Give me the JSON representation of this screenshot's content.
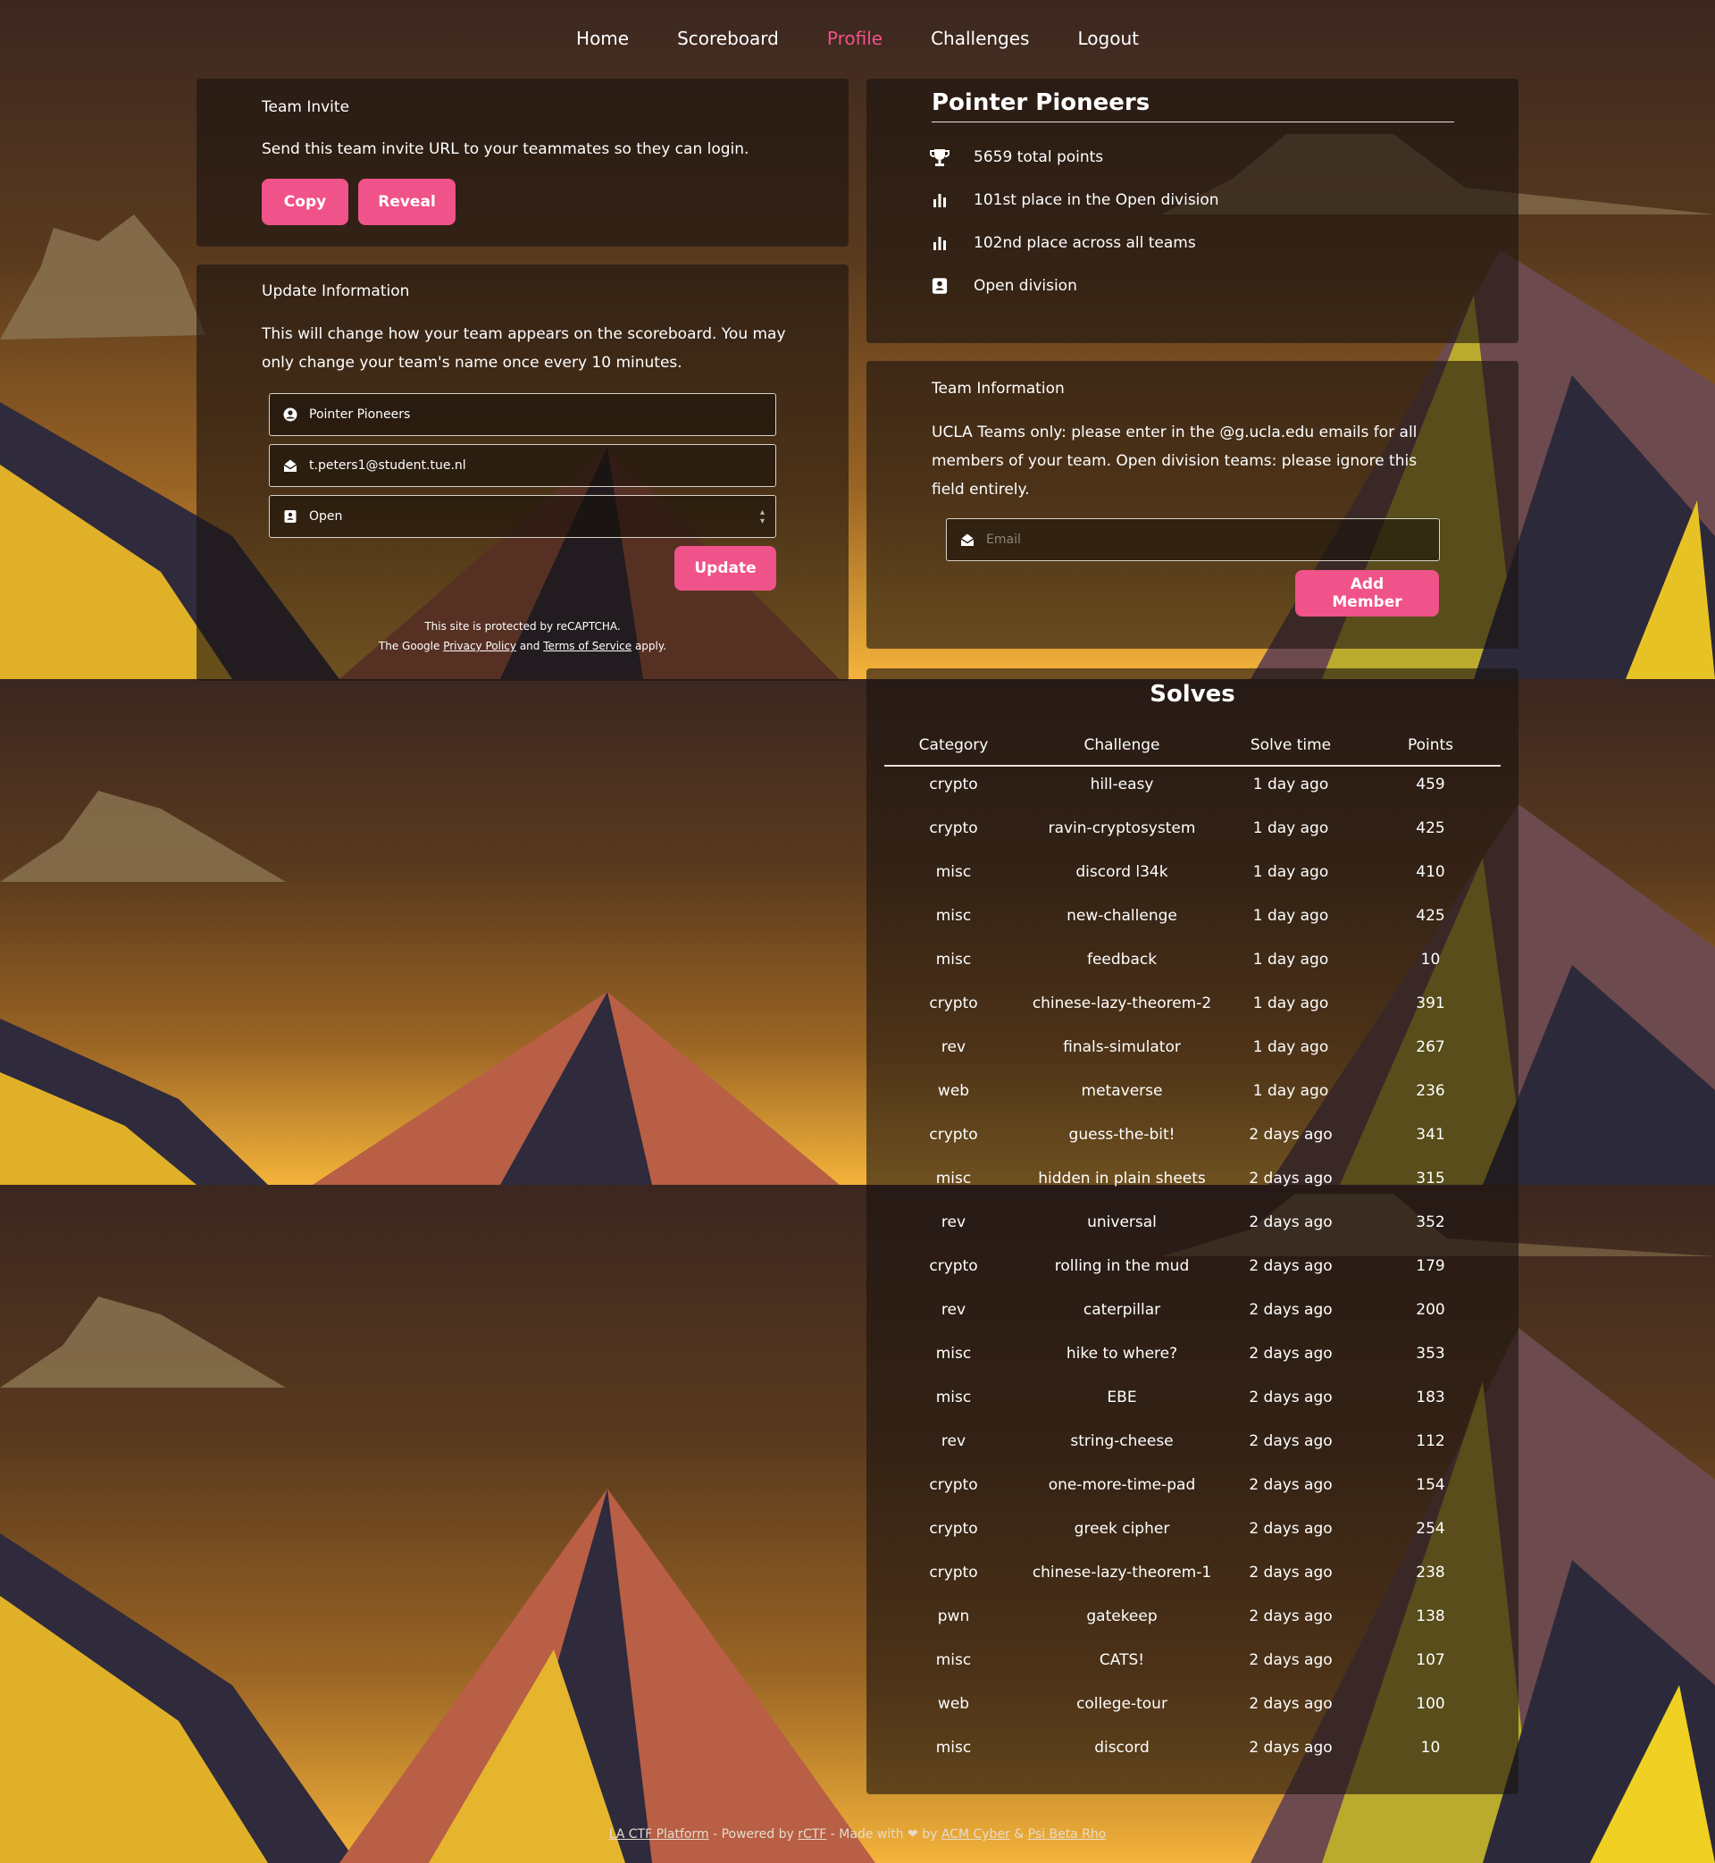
{
  "nav": {
    "items": [
      {
        "label": "Home",
        "active": false
      },
      {
        "label": "Scoreboard",
        "active": false
      },
      {
        "label": "Profile",
        "active": true
      },
      {
        "label": "Challenges",
        "active": false
      },
      {
        "label": "Logout",
        "active": false
      }
    ]
  },
  "invite": {
    "title": "Team Invite",
    "text": "Send this team invite URL to your teammates so they can login.",
    "copy_label": "Copy",
    "reveal_label": "Reveal"
  },
  "update": {
    "title": "Update Information",
    "text": "This will change how your team appears on the scoreboard. You may only change your team's name once every 10 minutes.",
    "name_value": "Pointer Pioneers",
    "email_value": "t.peters1@student.tue.nl",
    "division_value": "Open",
    "update_label": "Update",
    "recaptcha_line1": "This site is protected by reCAPTCHA.",
    "recaptcha_pre": "The Google",
    "privacy_label": "Privacy Policy",
    "and_label": "and",
    "terms_label": "Terms of Service",
    "apply_label": "apply."
  },
  "team": {
    "name": "Pointer Pioneers",
    "points": "5659 total points",
    "division_place": "101st place in the Open division",
    "overall_place": "102nd place across all teams",
    "division": "Open division"
  },
  "team_info": {
    "title": "Team Information",
    "text": "UCLA Teams only: please enter in the @g.ucla.edu emails for all members of your team. Open division teams: please ignore this field entirely.",
    "email_placeholder": "Email",
    "add_label": "Add Member"
  },
  "solves": {
    "title": "Solves",
    "headers": [
      "Category",
      "Challenge",
      "Solve time",
      "Points"
    ],
    "rows": [
      [
        "crypto",
        "hill-easy",
        "1 day ago",
        "459"
      ],
      [
        "crypto",
        "ravin-cryptosystem",
        "1 day ago",
        "425"
      ],
      [
        "misc",
        "discord l34k",
        "1 day ago",
        "410"
      ],
      [
        "misc",
        "new-challenge",
        "1 day ago",
        "425"
      ],
      [
        "misc",
        "feedback",
        "1 day ago",
        "10"
      ],
      [
        "crypto",
        "chinese-lazy-theorem-2",
        "1 day ago",
        "391"
      ],
      [
        "rev",
        "finals-simulator",
        "1 day ago",
        "267"
      ],
      [
        "web",
        "metaverse",
        "1 day ago",
        "236"
      ],
      [
        "crypto",
        "guess-the-bit!",
        "2 days ago",
        "341"
      ],
      [
        "misc",
        "hidden in plain sheets",
        "2 days ago",
        "315"
      ],
      [
        "rev",
        "universal",
        "2 days ago",
        "352"
      ],
      [
        "crypto",
        "rolling in the mud",
        "2 days ago",
        "179"
      ],
      [
        "rev",
        "caterpillar",
        "2 days ago",
        "200"
      ],
      [
        "misc",
        "hike to where?",
        "2 days ago",
        "353"
      ],
      [
        "misc",
        "EBE",
        "2 days ago",
        "183"
      ],
      [
        "rev",
        "string-cheese",
        "2 days ago",
        "112"
      ],
      [
        "crypto",
        "one-more-time-pad",
        "2 days ago",
        "154"
      ],
      [
        "crypto",
        "greek cipher",
        "2 days ago",
        "254"
      ],
      [
        "crypto",
        "chinese-lazy-theorem-1",
        "2 days ago",
        "238"
      ],
      [
        "pwn",
        "gatekeep",
        "2 days ago",
        "138"
      ],
      [
        "misc",
        "CATS!",
        "2 days ago",
        "107"
      ],
      [
        "web",
        "college-tour",
        "2 days ago",
        "100"
      ],
      [
        "misc",
        "discord",
        "2 days ago",
        "10"
      ]
    ]
  },
  "footer": {
    "platform": "LA CTF Platform",
    "powered": " - Powered by ",
    "rctf": "rCTF",
    "made": " - Made with ",
    "by": " by ",
    "acm": "ACM Cyber",
    "amp": " & ",
    "psi": "Psi Beta Rho"
  },
  "colors": {
    "accent": "#f0528a",
    "card_bg": "rgba(28,20,16,0.62)"
  },
  "icons": {
    "points": "trophy-icon",
    "place": "bar-chart-icon",
    "division": "contact-card-icon",
    "name": "user-circle-icon",
    "email": "envelope-open-icon"
  }
}
